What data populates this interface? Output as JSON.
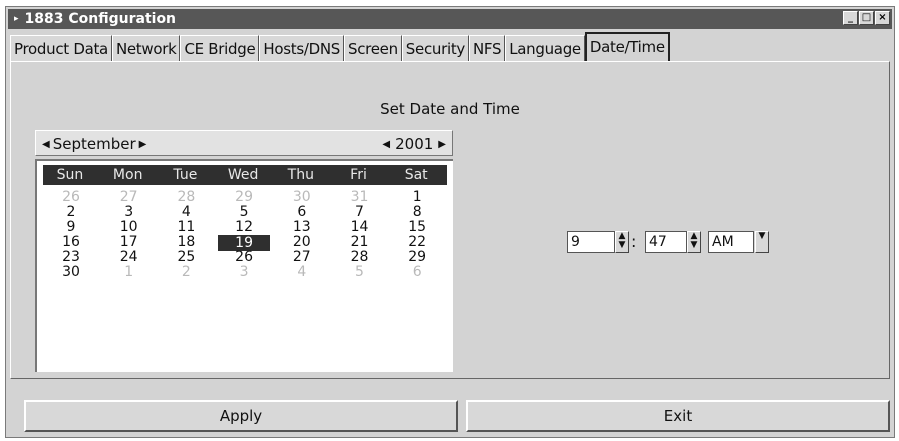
{
  "window": {
    "title": "1883 Configuration",
    "app_icon": "app-icon"
  },
  "window_controls": {
    "minimize": "_",
    "maximize": "□",
    "close": "×"
  },
  "tabs": [
    {
      "label": "Product Data",
      "active": false
    },
    {
      "label": "Network",
      "active": false
    },
    {
      "label": "CE Bridge",
      "active": false
    },
    {
      "label": "Hosts/DNS",
      "active": false
    },
    {
      "label": "Screen",
      "active": false
    },
    {
      "label": "Security",
      "active": false
    },
    {
      "label": "NFS",
      "active": false
    },
    {
      "label": "Language",
      "active": false
    },
    {
      "label": "Date/Time",
      "active": true
    }
  ],
  "panel": {
    "title": "Set Date and Time"
  },
  "calendar": {
    "month": "September",
    "year": "2001",
    "weekdays": [
      "Sun",
      "Mon",
      "Tue",
      "Wed",
      "Thu",
      "Fri",
      "Sat"
    ],
    "weeks": [
      [
        "26",
        "27",
        "28",
        "29",
        "30",
        "31",
        "1"
      ],
      [
        "2",
        "3",
        "4",
        "5",
        "6",
        "7",
        "8"
      ],
      [
        "9",
        "10",
        "11",
        "12",
        "13",
        "14",
        "15"
      ],
      [
        "16",
        "17",
        "18",
        "19",
        "20",
        "21",
        "22"
      ],
      [
        "23",
        "24",
        "25",
        "26",
        "27",
        "28",
        "29"
      ],
      [
        "30",
        "1",
        "2",
        "3",
        "4",
        "5",
        "6"
      ]
    ],
    "selected_day": "19"
  },
  "time": {
    "hour": "9",
    "minute": "47",
    "ampm": "AM",
    "separator": ":"
  },
  "buttons": {
    "apply": "Apply",
    "exit": "Exit"
  }
}
